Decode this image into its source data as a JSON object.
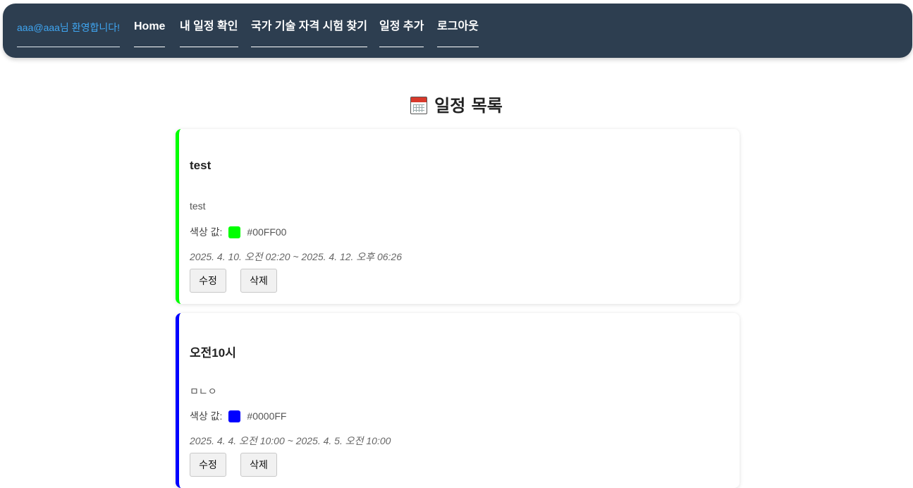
{
  "nav": {
    "welcome": "aaa@aaa님 환영합니다!",
    "items": [
      {
        "label": "Home"
      },
      {
        "label": "내 일정 확인"
      },
      {
        "label": "국가 기술 자격 시험 찾기"
      },
      {
        "label": "일정 추가"
      },
      {
        "label": "로그아웃"
      }
    ]
  },
  "page": {
    "title": "일정 목록",
    "title_icon": "calendar-icon"
  },
  "labels": {
    "color_label": "색상 값:",
    "edit": "수정",
    "delete": "삭제"
  },
  "schedules": [
    {
      "title": "test",
      "description": "test",
      "color": "#00FF00",
      "period": "2025. 4. 10. 오전 02:20 ~ 2025. 4. 12. 오후 06:26"
    },
    {
      "title": "오전10시",
      "description": "ㅁㄴㅇ",
      "color": "#0000FF",
      "period": "2025. 4. 4. 오전 10:00 ~ 2025. 4. 5. 오전 10:00"
    }
  ]
}
